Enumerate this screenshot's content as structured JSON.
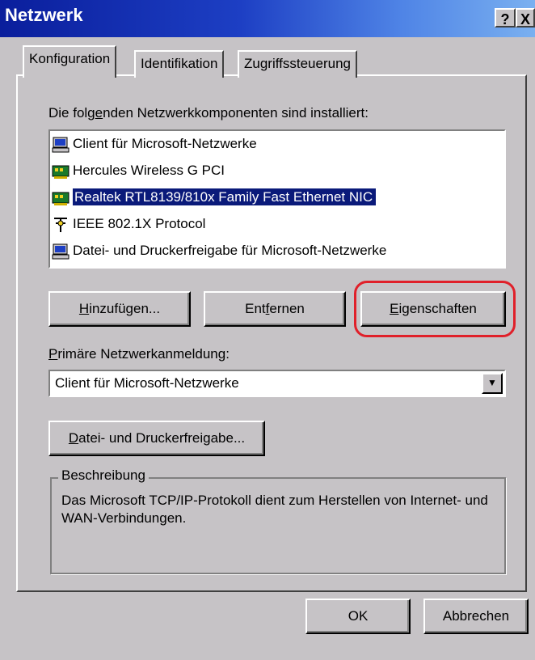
{
  "window": {
    "title": "Netzwerk",
    "help_glyph": "?",
    "close_glyph": "X"
  },
  "tabs": [
    {
      "label": "Konfiguration",
      "active": true
    },
    {
      "label": "Identifikation",
      "active": false
    },
    {
      "label": "Zugriffssteuerung",
      "active": false
    }
  ],
  "components": {
    "label_pre": "Die folg",
    "label_mnemonic": "e",
    "label_post": "nden Netzwerkkomponenten sind installiert:",
    "items": [
      {
        "label": "Client für Microsoft-Netzwerke",
        "icon": "computer-icon",
        "selected": false
      },
      {
        "label": "Hercules Wireless G PCI",
        "icon": "network-card-icon",
        "selected": false
      },
      {
        "label": "Realtek RTL8139/810x Family Fast Ethernet NIC",
        "icon": "network-card-icon",
        "selected": true
      },
      {
        "label": "IEEE 802.1X Protocol",
        "icon": "protocol-icon",
        "selected": false
      },
      {
        "label": "Datei- und Druckerfreigabe für Microsoft-Netzwerke",
        "icon": "computer-icon",
        "selected": false
      }
    ]
  },
  "buttons": {
    "add_mn": "H",
    "add_rest": "inzufügen...",
    "remove_pre": "Ent",
    "remove_mn": "f",
    "remove_post": "ernen",
    "properties_mn": "E",
    "properties_rest": "igenschaften",
    "file_share_mn": "D",
    "file_share_rest": "atei- und Druckerfreigabe...",
    "ok": "OK",
    "cancel": "Abbrechen"
  },
  "primary_logon": {
    "label_mn": "P",
    "label_rest": "rimäre Netzwerkanmeldung:",
    "value": "Client für Microsoft-Netzwerke"
  },
  "description": {
    "legend": "Beschreibung",
    "text": "Das Microsoft TCP/IP-Protokoll dient zum Herstellen von Internet- und WAN-Verbindungen."
  },
  "colors": {
    "title_bar_start": "#0a1e9c",
    "selection": "#0a1a7a",
    "highlight_ring": "#e0202a",
    "face": "#c6c3c6"
  }
}
